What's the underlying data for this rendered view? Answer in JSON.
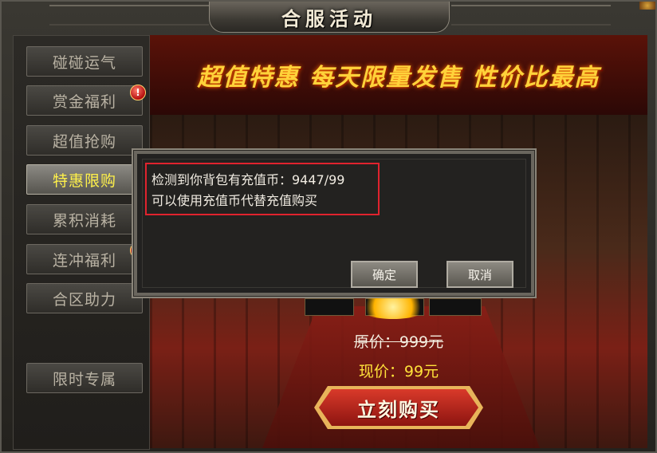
{
  "window": {
    "title": "合服活动"
  },
  "sidebar": {
    "items": [
      {
        "label": "碰碰运气",
        "active": false,
        "alert": false
      },
      {
        "label": "赏金福利",
        "active": false,
        "alert": true
      },
      {
        "label": "超值抢购",
        "active": false,
        "alert": false
      },
      {
        "label": "特惠限购",
        "active": true,
        "alert": false
      },
      {
        "label": "累积消耗",
        "active": false,
        "alert": false
      },
      {
        "label": "连冲福利",
        "active": false,
        "alert": true
      },
      {
        "label": "合区助力",
        "active": false,
        "alert": false
      },
      {
        "label": "限时专属",
        "active": false,
        "alert": false
      }
    ],
    "alert_glyph": "!"
  },
  "banner": {
    "text": "超值特惠  每天限量发售  性价比最高"
  },
  "offer": {
    "original_price": "原价：999元",
    "current_price": "现价：99元",
    "buy_label": "立刻购买"
  },
  "dialog": {
    "line1": "检测到你背包有充值币：9447/99",
    "line2": "可以使用充值币代替充值购买",
    "ok_label": "确定",
    "cancel_label": "取消"
  },
  "colors": {
    "active_text": "#fff14a",
    "price_current": "#ffe23a",
    "highlight_border": "#e0232e",
    "banner_text": "#ffd23a"
  }
}
